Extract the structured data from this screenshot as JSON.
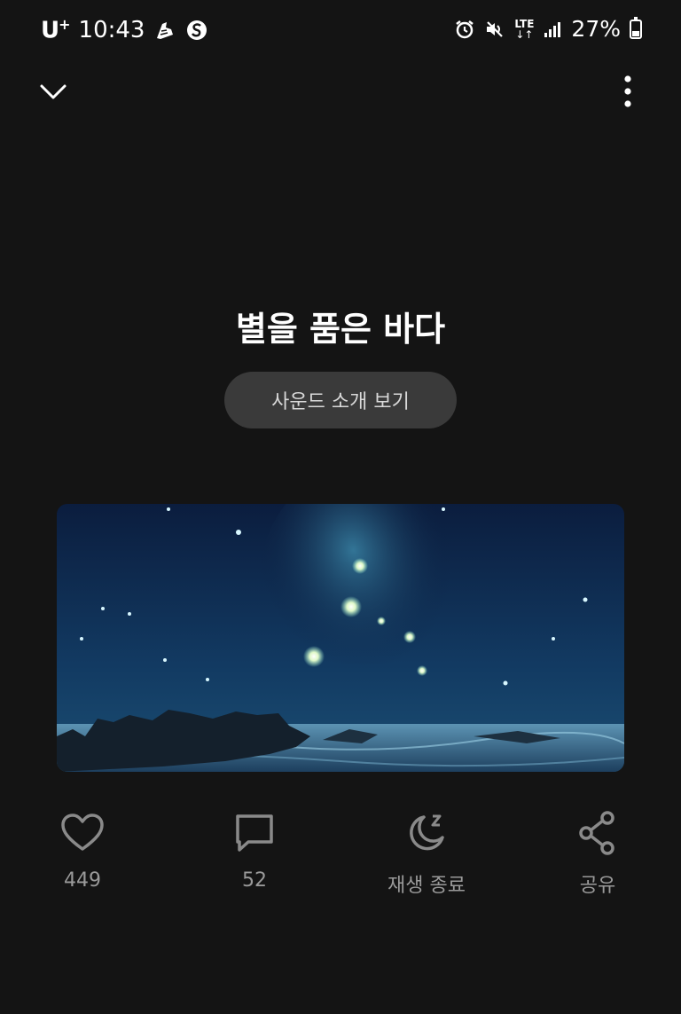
{
  "status_bar": {
    "carrier": "U",
    "carrier_sup": "+",
    "time": "10:43",
    "network": "LTE",
    "battery": "27%"
  },
  "header": {
    "collapse_icon": "chevron-down-icon",
    "more_icon": "more-vertical-icon"
  },
  "sound": {
    "title": "별을 품은 바다",
    "intro_button": "사운드 소개 보기"
  },
  "actions": [
    {
      "icon": "heart-icon",
      "label": "449"
    },
    {
      "icon": "comment-icon",
      "label": "52"
    },
    {
      "icon": "sleep-timer-icon",
      "label": "재생 종료"
    },
    {
      "icon": "share-icon",
      "label": "공유"
    }
  ],
  "colors": {
    "background": "#141414",
    "button_bg": "#3a3a3a",
    "label": "#9a9a9a",
    "icon": "#8a8a8a"
  }
}
